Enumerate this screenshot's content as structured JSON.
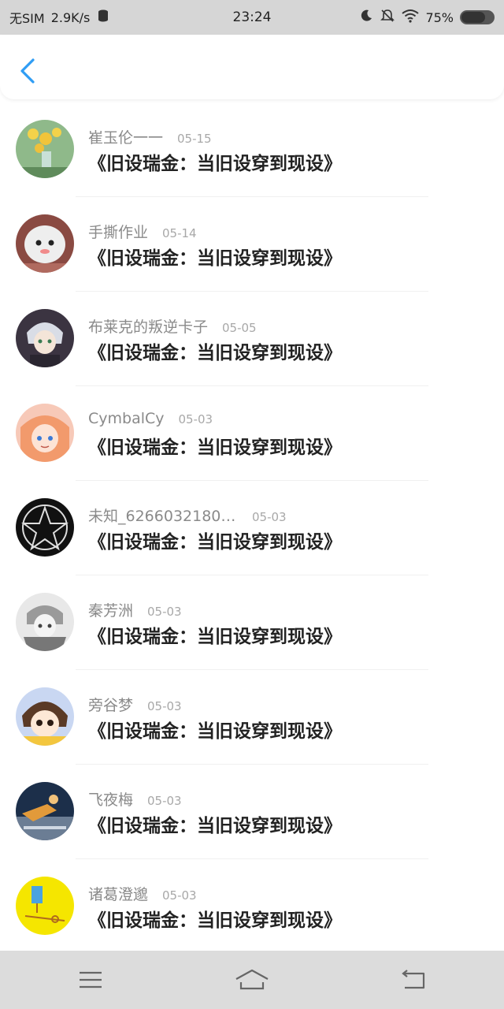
{
  "status_bar": {
    "carrier": "无SIM",
    "speed": "2.9K/s",
    "time": "23:24",
    "battery": "75%"
  },
  "header": {
    "back_icon": "chevron-left-icon"
  },
  "colors": {
    "accent": "#2f9df4",
    "status_bg": "#d6d6d6",
    "nav_bg": "#dcdcdc"
  },
  "items": [
    {
      "author": "崔玉伦一一",
      "date": "05-15",
      "title": "《旧设瑞金：当旧设穿到现设》"
    },
    {
      "author": "手撕作业",
      "date": "05-14",
      "title": "《旧设瑞金：当旧设穿到现设》"
    },
    {
      "author": "布莱克的叛逆卡子",
      "date": "05-05",
      "title": "《旧设瑞金：当旧设穿到现设》"
    },
    {
      "author": "CymbalCy",
      "date": "05-03",
      "title": "《旧设瑞金：当旧设穿到现设》"
    },
    {
      "author": "未知_62660321803...",
      "date": "05-03",
      "title": "《旧设瑞金：当旧设穿到现设》"
    },
    {
      "author": "秦芳洲",
      "date": "05-03",
      "title": "《旧设瑞金：当旧设穿到现设》"
    },
    {
      "author": "旁谷梦",
      "date": "05-03",
      "title": "《旧设瑞金：当旧设穿到现设》"
    },
    {
      "author": "飞夜梅",
      "date": "05-03",
      "title": "《旧设瑞金：当旧设穿到现设》"
    },
    {
      "author": "诸葛澄邈",
      "date": "05-03",
      "title": "《旧设瑞金：当旧设穿到现设》"
    }
  ],
  "nav": {
    "menu_icon": "menu-icon",
    "home_icon": "home-icon",
    "back_icon": "back-icon"
  }
}
